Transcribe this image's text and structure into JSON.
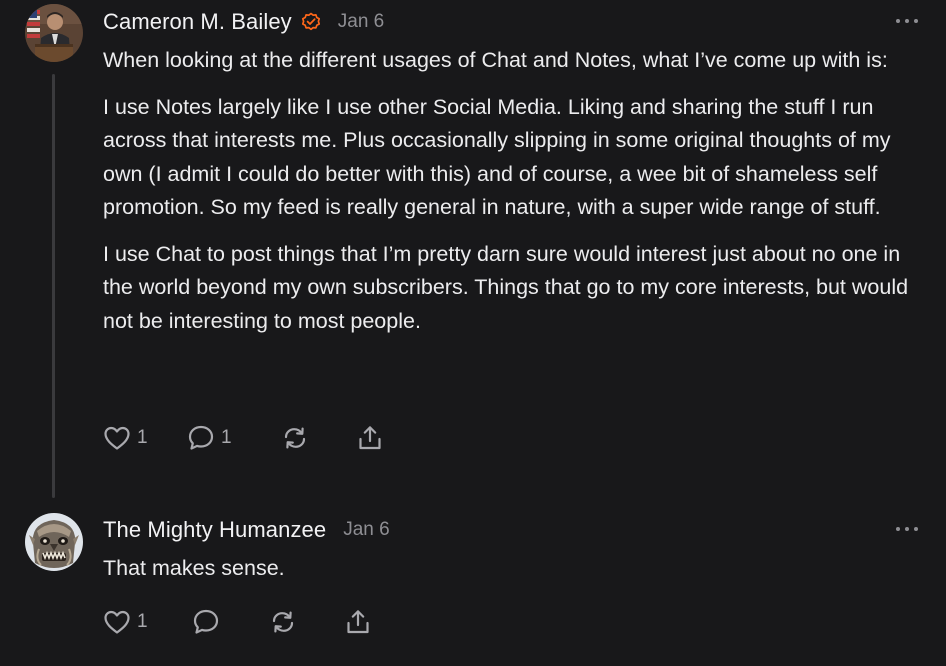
{
  "comments": [
    {
      "author": "Cameron M. Bailey",
      "verified": true,
      "date": "Jan 6",
      "paragraphs": [
        "When looking at the different usages of Chat and Notes, what I’ve come up with is:",
        "I use Notes largely like I use other Social Media. Liking and sharing the stuff I run across that interests me. Plus occasionally slipping in some original thoughts of my own (I admit I could do better with this) and of course, a wee bit of shameless self promotion. So my feed is really general in nature, with a super wide range of stuff.",
        "I use Chat to post things that I’m pretty darn sure would interest just about no one in the world beyond my own subscribers. Things that go to my core interests, but would not be interesting to most people."
      ],
      "likes": "1",
      "replies": "1",
      "icons": [
        "heart-icon",
        "comment-icon",
        "restack-icon",
        "share-icon",
        "more-icon",
        "verified-check-icon"
      ]
    },
    {
      "author": "The Mighty Humanzee",
      "verified": false,
      "date": "Jan 6",
      "paragraphs": [
        "That makes sense."
      ],
      "likes": "1",
      "replies": "",
      "icons": [
        "heart-icon",
        "comment-icon",
        "restack-icon",
        "share-icon",
        "more-icon"
      ]
    }
  ],
  "colors": {
    "background": "#18181a",
    "text": "#ececee",
    "muted": "#8e8e93",
    "accent": "#ff6719",
    "thread_line": "#3a3a3d"
  }
}
